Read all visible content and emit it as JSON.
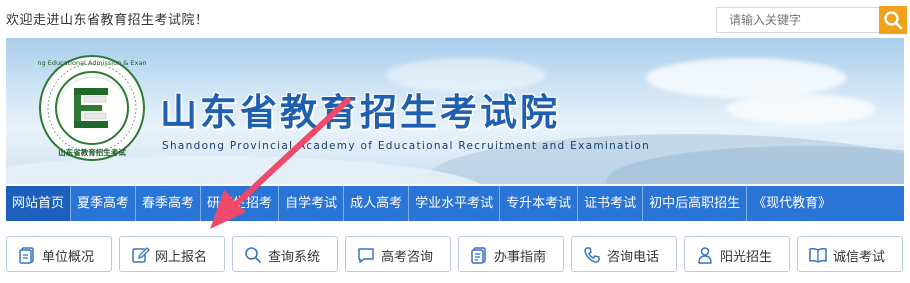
{
  "header": {
    "welcome_text": "欢迎走进山东省教育招生考试院！",
    "search_placeholder": "请输入关键字",
    "search_icon": "search-icon"
  },
  "banner": {
    "title": "山东省教育招生考试院",
    "subtitle": "Shandong Provincial Academy of Educational Recruitment and Examination",
    "logo_text_en": "Shandong Educational Admission & Examination",
    "logo_text_cn": "山东省教育招生考试"
  },
  "nav": {
    "items": [
      {
        "label": "网站首页"
      },
      {
        "label": "夏季高考"
      },
      {
        "label": "春季高考"
      },
      {
        "label": "研究生招考"
      },
      {
        "label": "自学考试"
      },
      {
        "label": "成人高考"
      },
      {
        "label": "学业水平考试"
      },
      {
        "label": "专升本考试"
      },
      {
        "label": "证书考试"
      },
      {
        "label": "初中后高职招生"
      },
      {
        "label": "《现代教育》"
      }
    ]
  },
  "quick_links": [
    {
      "label": "单位概况",
      "icon": "document-icon"
    },
    {
      "label": "网上报名",
      "icon": "edit-icon"
    },
    {
      "label": "查询系统",
      "icon": "search-icon"
    },
    {
      "label": "高考咨询",
      "icon": "chat-icon"
    },
    {
      "label": "办事指南",
      "icon": "guide-icon"
    },
    {
      "label": "咨询电话",
      "icon": "phone-icon"
    },
    {
      "label": "阳光招生",
      "icon": "person-icon"
    },
    {
      "label": "诚信考试",
      "icon": "book-icon"
    }
  ],
  "colors": {
    "nav_bg": "#2a74d6",
    "nav_active": "#1d5fbd",
    "search_button": "#f2a21a",
    "title": "#1f5fb0",
    "arrow": "#f04a6a"
  }
}
